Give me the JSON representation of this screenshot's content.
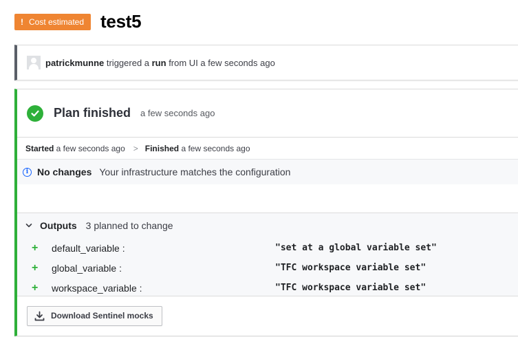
{
  "header": {
    "badge_icon": "!",
    "badge_label": "Cost estimated",
    "title": "test5"
  },
  "trigger": {
    "user": "patrickmunne",
    "text1": " triggered a ",
    "run_word": "run",
    "text2": " from UI a few seconds ago"
  },
  "plan": {
    "title": "Plan finished",
    "time": "a few seconds ago",
    "started_label": "Started",
    "started_time": " a few seconds ago",
    "separator": ">",
    "finished_label": "Finished",
    "finished_time": " a few seconds ago",
    "info_icon": "i",
    "no_changes_label": "No changes",
    "no_changes_text": "Your infrastructure matches the configuration"
  },
  "outputs": {
    "label": "Outputs",
    "summary": "3 planned to change",
    "items": [
      {
        "marker": "+",
        "name": "default_variable :",
        "value": "\"set at a global variable set\""
      },
      {
        "marker": "+",
        "name": "global_variable :",
        "value": "\"TFC workspace variable set\""
      },
      {
        "marker": "+",
        "name": "workspace_variable :",
        "value": "\"TFC workspace variable set\""
      }
    ]
  },
  "actions": {
    "download_label": "Download Sentinel mocks"
  },
  "colors": {
    "badge": "#ef8532",
    "success": "#2eb039",
    "info": "#1563ff",
    "trigger_border": "#5a5f68"
  },
  "icons": {
    "badge": "exclamation-icon",
    "avatar": "user-avatar-icon",
    "status": "check-circle-icon",
    "info": "info-circle-icon",
    "expand": "chevron-down-icon",
    "download": "download-icon"
  }
}
